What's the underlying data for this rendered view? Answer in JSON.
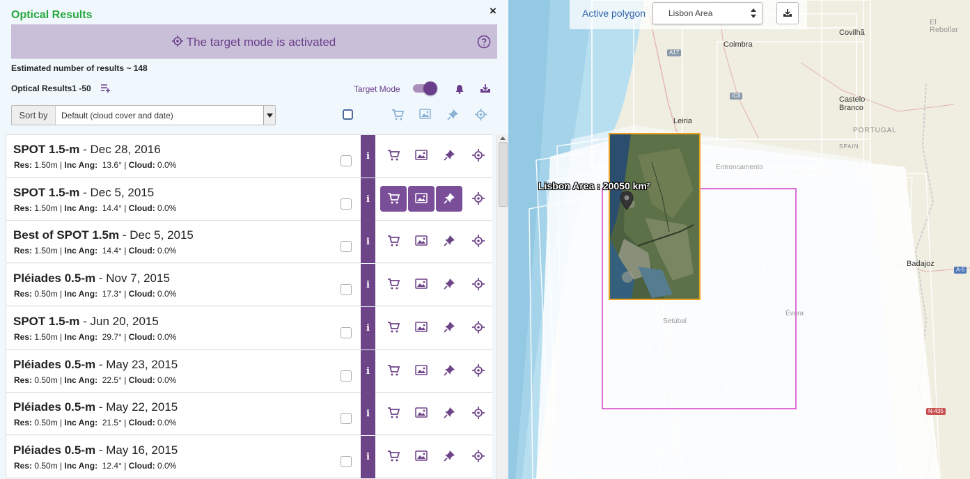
{
  "panel": {
    "title": "Optical Results",
    "close": "×",
    "banner_text": "The target mode is activated",
    "estimate": "Estimated number of results ~ 148",
    "result_count": "Optical Results1 -50",
    "target_mode_label": "Target Mode",
    "target_mode_on": true,
    "sort_label": "Sort by",
    "sort_value": "Default (cloud cover and date)"
  },
  "results": [
    {
      "name": "SPOT 1.5-m",
      "date": " - Dec 28, 2016",
      "res": "1.50m",
      "inc": "13.6°",
      "cloud": "0.0%"
    },
    {
      "name": "SPOT 1.5-m",
      "date": " - Dec 5, 2015",
      "res": "1.50m",
      "inc": "14.4°",
      "cloud": "0.0%"
    },
    {
      "name": "Best of SPOT 1.5m",
      "date": " - Dec 5, 2015",
      "res": "1.50m",
      "inc": "14.4°",
      "cloud": "0.0%"
    },
    {
      "name": "Pléiades 0.5-m",
      "date": " - Nov 7, 2015",
      "res": "0.50m",
      "inc": "17.3°",
      "cloud": "0.0%"
    },
    {
      "name": "SPOT 1.5-m",
      "date": " - Jun 20, 2015",
      "res": "1.50m",
      "inc": "29.7°",
      "cloud": "0.0%"
    },
    {
      "name": "Pléiades 0.5-m",
      "date": " - May 23, 2015",
      "res": "0.50m",
      "inc": "22.5°",
      "cloud": "0.0%"
    },
    {
      "name": "Pléiades 0.5-m",
      "date": " - May 22, 2015",
      "res": "0.50m",
      "inc": "21.5°",
      "cloud": "0.0%"
    },
    {
      "name": "Pléiades 0.5-m",
      "date": " - May 16, 2015",
      "res": "0.50m",
      "inc": "12.4°",
      "cloud": "0.0%"
    }
  ],
  "labels": {
    "res": "Res:",
    "inc": "Inc Ang:",
    "cloud": "Cloud:",
    "sep": " | ",
    "info": "i"
  },
  "map": {
    "active_polygon_label": "Active polygon",
    "active_polygon_value": "Lisbon Area",
    "area_label": "Lisbon Area : 20050 km²",
    "places": {
      "coimbra": "Coimbra",
      "covilha": "Covilhã",
      "el_rebollar": "El\nRebollar",
      "castelo_branco": "Castelo\nBranco",
      "portugal": "PORTUGAL",
      "spain": "SPAIN",
      "leiria": "Leiria",
      "entroncamento": "Entroncamento",
      "setubal": "Setúbal",
      "evora": "Évora",
      "badajoz": "Badajoz"
    },
    "shields": {
      "a17": "A17",
      "ic8": "IC8",
      "a5": "A-5",
      "n435": "N-435"
    }
  },
  "colors": {
    "accent": "#6e4489",
    "title_green": "#26a83d",
    "banner": "#c9bfd8",
    "polygon": "#d43fc9",
    "thumb_border": "#e9a321"
  }
}
